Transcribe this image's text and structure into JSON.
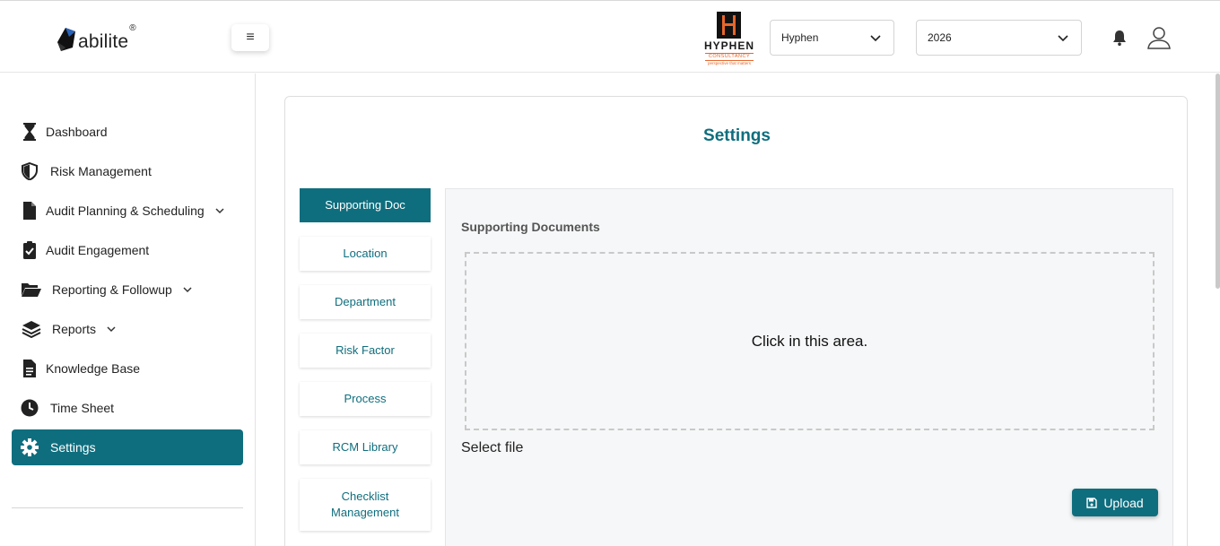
{
  "header": {
    "logo_text": "abilite",
    "logo_reg": "®",
    "menu_glyph": "≡",
    "company_logo": {
      "name": "HYPHEN",
      "sub": "CONSULTANCY",
      "tag": "perspective that matters"
    },
    "company_select": {
      "value": "Hyphen"
    },
    "year_select": {
      "value": "2026"
    },
    "icons": {
      "menu": "hamburger-icon",
      "notifications": "bell-icon",
      "profile": "user-icon"
    }
  },
  "sidebar": {
    "items": [
      {
        "label": "Dashboard",
        "icon": "hourglass-icon",
        "caret": false,
        "active": false
      },
      {
        "label": "Risk Management",
        "icon": "shield-icon",
        "caret": false,
        "active": false
      },
      {
        "label": "Audit Planning & Scheduling",
        "icon": "file-icon",
        "caret": true,
        "active": false
      },
      {
        "label": "Audit Engagement",
        "icon": "clipboard-check-icon",
        "caret": false,
        "active": false
      },
      {
        "label": "Reporting & Followup",
        "icon": "folder-open-icon",
        "caret": true,
        "active": false
      },
      {
        "label": "Reports",
        "icon": "layers-icon",
        "caret": true,
        "active": false
      },
      {
        "label": "Knowledge Base",
        "icon": "document-icon",
        "caret": false,
        "active": false
      },
      {
        "label": "Time Sheet",
        "icon": "clock-icon",
        "caret": false,
        "active": false
      },
      {
        "label": "Settings",
        "icon": "gear-icon",
        "caret": false,
        "active": true
      }
    ]
  },
  "main": {
    "title": "Settings",
    "tabs": [
      {
        "label": "Supporting Doc",
        "active": true
      },
      {
        "label": "Location",
        "active": false
      },
      {
        "label": "Department",
        "active": false
      },
      {
        "label": "Risk Factor",
        "active": false
      },
      {
        "label": "Process",
        "active": false
      },
      {
        "label": "RCM Library",
        "active": false
      },
      {
        "label": "Checklist Management",
        "active": false
      }
    ],
    "panel": {
      "title": "Supporting Documents",
      "dropzone_text": "Click in this area.",
      "select_file_text": "Select file",
      "upload_label": "Upload",
      "upload_icon": "floppy-disk-icon"
    }
  },
  "colors": {
    "accent": "#0f6e7e",
    "brand_orange": "#e8672b"
  }
}
